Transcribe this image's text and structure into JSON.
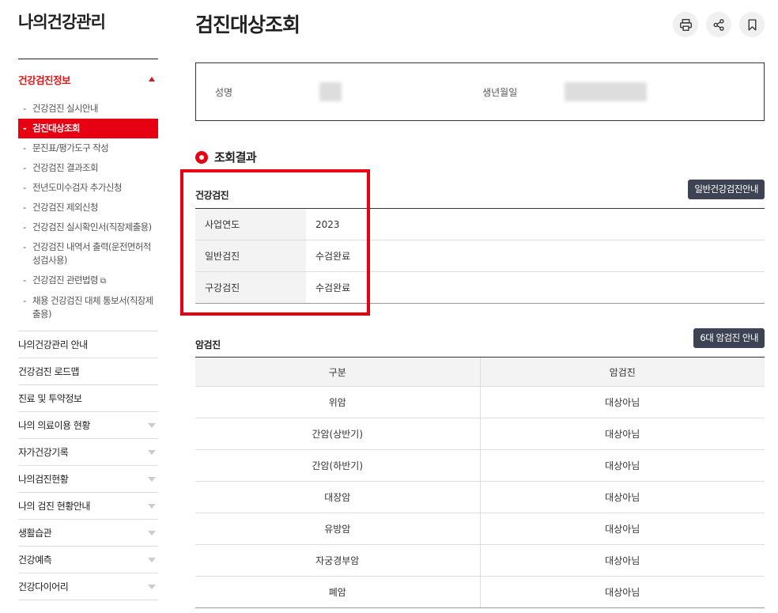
{
  "sidebar": {
    "title": "나의건강관리",
    "section_label": "건강검진정보",
    "sub_items": [
      "건강검진 실시안내",
      "검진대상조회",
      "문진표/평가도구 작성",
      "건강검진 결과조회",
      "전년도미수검자 추가신청",
      "건강검진 제외신청",
      "건강검진 실시확인서(직장제출용)",
      "건강검진 내역서 출력(운전면허적성검사용)",
      "건강검진 관련법령",
      "채용 건강검진 대체 통보서(직장제출용)"
    ],
    "menu": [
      "나의건강관리 안내",
      "건강검진 로드맵",
      "진료 및 투약정보",
      "나의 의료이용 현황",
      "자가건강기록",
      "나의검진현황",
      "나의 검진 현황안내",
      "생활습관",
      "건강예측",
      "건강다이어리"
    ]
  },
  "main": {
    "title": "검진대상조회",
    "name_label": "성명",
    "birth_label": "생년월일",
    "result_heading": "조회결과",
    "health_section": {
      "title": "건강검진",
      "button": "일반건강검진안내",
      "rows": [
        {
          "key": "사업연도",
          "value": "2023"
        },
        {
          "key": "일반검진",
          "value": "수검완료"
        },
        {
          "key": "구강검진",
          "value": "수검완료"
        }
      ]
    },
    "cancer_section": {
      "title": "암검진",
      "button": "6대 암검진 안내",
      "headers": [
        "구분",
        "암검진"
      ],
      "rows": [
        [
          "위암",
          "대상아님"
        ],
        [
          "간암(상반기)",
          "대상아님"
        ],
        [
          "간암(하반기)",
          "대상아님"
        ],
        [
          "대장암",
          "대상아님"
        ],
        [
          "유방암",
          "대상아님"
        ],
        [
          "자궁경부암",
          "대상아님"
        ],
        [
          "폐암",
          "대상아님"
        ]
      ]
    }
  },
  "colors": {
    "accent": "#e60012",
    "dark_button": "#3e4354"
  }
}
